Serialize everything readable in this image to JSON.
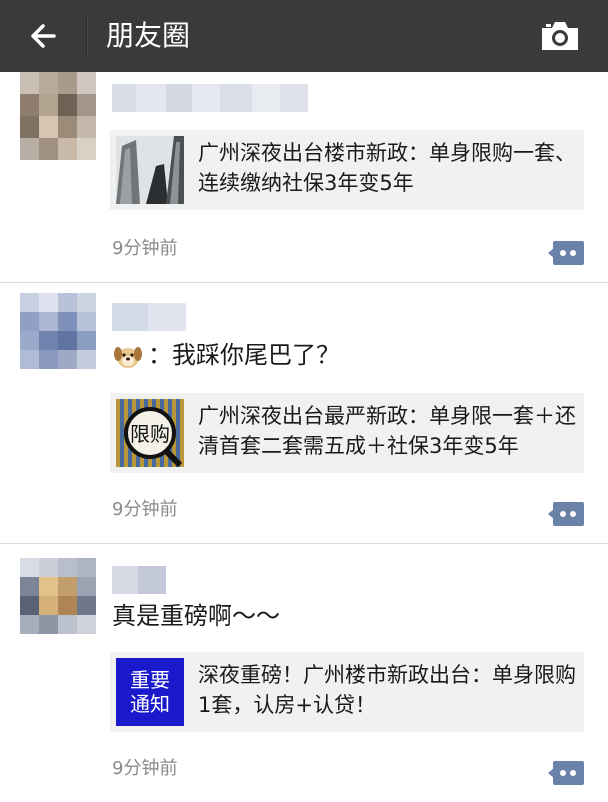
{
  "topbar": {
    "title": "朋友圈",
    "back_icon": "arrow-left-icon",
    "camera_icon": "camera-icon"
  },
  "posts": [
    {
      "text": "",
      "link": {
        "title": "广州深夜出台楼市新政：单身限购一套、连续缴纳社保3年变5年",
        "thumb": "skyscraper-photo"
      },
      "time": "9分钟前",
      "comment_icon": "comment-dots-icon"
    },
    {
      "text_emoji": "dog-emoji",
      "text": "：我踩你尾巴了？",
      "link": {
        "title": "广州深夜出台最严新政：单身限一套＋还清首套二套需五成＋社保3年变5年",
        "thumb": "限购",
        "thumb_text": "限购"
      },
      "time": "9分钟前",
      "comment_icon": "comment-dots-icon"
    },
    {
      "text": "真是重磅啊～～",
      "link": {
        "title": "深夜重磅！广州楼市新政出台：单身限购1套，认房+认贷！",
        "thumb_line1": "重要",
        "thumb_line2": "通知"
      },
      "time": "9分钟前",
      "comment_icon": "comment-dots-icon"
    }
  ],
  "colors": {
    "topbar": "#3a3a3c",
    "card_bg": "#f1f1f1",
    "time_text": "#8a8a8a",
    "comment_icon": "#6b82a8",
    "notice_blue": "#1a1acc"
  }
}
